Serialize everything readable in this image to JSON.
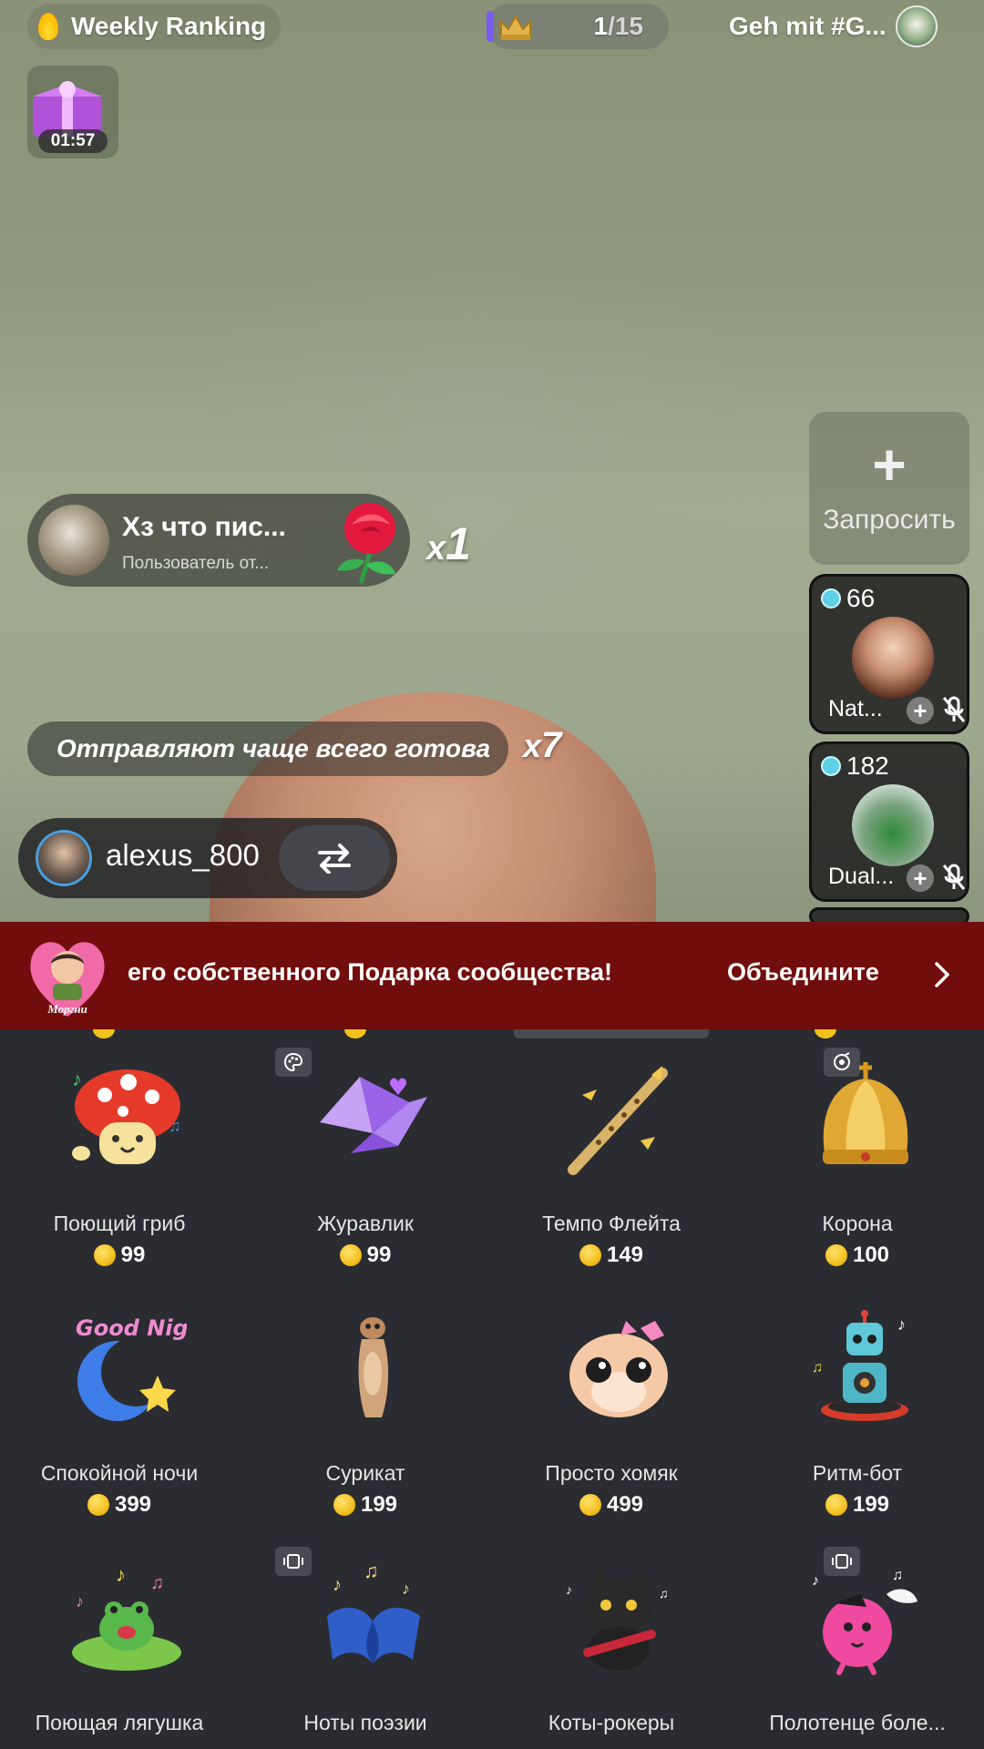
{
  "top_bar": {
    "ranking_label": "Weekly Ranking",
    "rank_current": "1",
    "rank_total": "/15",
    "event_label": "Geh mit #G..."
  },
  "gift_timer": {
    "time": "01:57"
  },
  "gift_message": {
    "sender": "Хз что пис...",
    "subtitle": "Пользователь  от...",
    "combo": "1"
  },
  "most_sent": {
    "text": "Отправляют чаще всего готова",
    "combo": "7"
  },
  "host": {
    "username": "alexus_800"
  },
  "request": {
    "label": "Запросить"
  },
  "guests": [
    {
      "score": "66",
      "name": "Nat..."
    },
    {
      "score": "182",
      "name": "Dual..."
    }
  ],
  "community_banner": {
    "badge_text": "Моргни",
    "text": "его собственного Подарка сообщества!",
    "cta": "Объедините"
  },
  "gifts": [
    {
      "name": "Поющий гриб",
      "price": "99",
      "icon": "singing-mushroom"
    },
    {
      "name": "Журавлик",
      "price": "99",
      "icon": "paper-crane"
    },
    {
      "name": "Темпо Флейта",
      "price": "149",
      "icon": "flute"
    },
    {
      "name": "Корона",
      "price": "100",
      "icon": "crown"
    },
    {
      "name": "Спокойной ночи",
      "price": "399",
      "icon": "good-night-moon"
    },
    {
      "name": "Сурикат",
      "price": "199",
      "icon": "meerkat"
    },
    {
      "name": "Просто хомяк",
      "price": "499",
      "icon": "hamster"
    },
    {
      "name": "Ритм-бот",
      "price": "199",
      "icon": "rhythm-bot"
    },
    {
      "name": "Поющая лягушка",
      "price": "",
      "icon": "singing-frog"
    },
    {
      "name": "Ноты поэзии",
      "price": "",
      "icon": "poetry-book"
    },
    {
      "name": "Коты-рокеры",
      "price": "",
      "icon": "rocker-cat"
    },
    {
      "name": "Полотенце боле...",
      "price": "",
      "icon": "towel-ball"
    }
  ],
  "colors": {
    "panel_bg": "#2b2c31",
    "banner_bg": "#720d0d",
    "coin": "#f2c01e",
    "gem": "#5fd1e6"
  }
}
